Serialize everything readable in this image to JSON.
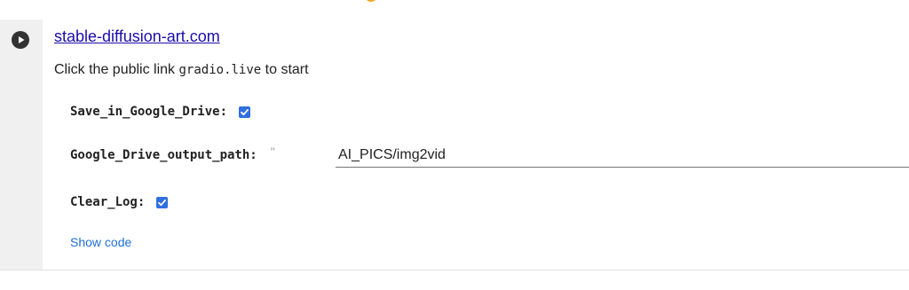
{
  "cell": {
    "link_text": "stable-diffusion-art.com",
    "intro_prefix": "Click the public link ",
    "intro_code": "gradio.live",
    "intro_suffix": " to start",
    "show_code_label": "Show code"
  },
  "form": {
    "save_in_drive": {
      "label": "Save_in_Google_Drive:",
      "checked": true
    },
    "output_path": {
      "label": "Google_Drive_output_path:",
      "quote": "\"",
      "value": "AI_PICS/img2vid"
    },
    "clear_log": {
      "label": "Clear_Log:",
      "checked": true
    }
  },
  "icons": {
    "run": "play-icon",
    "checkbox": "checkmark-icon",
    "spinner": "loading-ring-icon"
  },
  "colors": {
    "link": "#1a0dab",
    "checkbox": "#2f6fdf",
    "show_code": "#1f6fd6",
    "gutter": "#f0f0f0",
    "spinner": "#f5a623"
  }
}
